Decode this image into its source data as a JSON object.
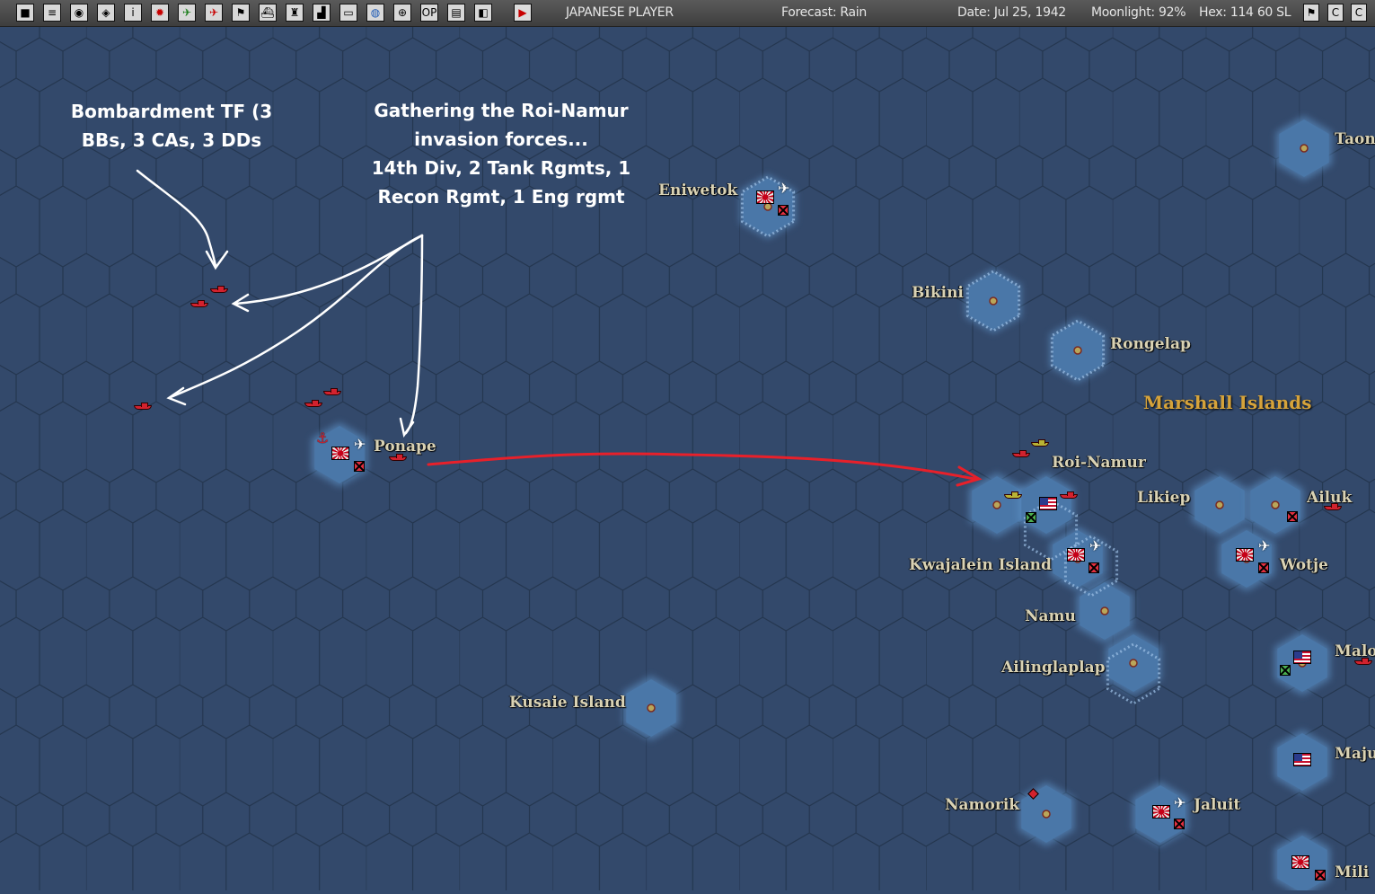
{
  "toolbar": {
    "buttons": [
      {
        "icon": "square-icon",
        "glyph": "■"
      },
      {
        "icon": "list-icon",
        "glyph": "≡"
      },
      {
        "icon": "pilots-icon",
        "glyph": "◉"
      },
      {
        "icon": "ships-icon",
        "glyph": "◈"
      },
      {
        "icon": "info-icon",
        "glyph": "i"
      },
      {
        "icon": "japan-flag-icon",
        "glyph": "✹"
      },
      {
        "icon": "aircraft-icon",
        "glyph": "✈"
      },
      {
        "icon": "bomber-icon",
        "glyph": "✈"
      },
      {
        "icon": "flag-icon",
        "glyph": "⚑"
      },
      {
        "icon": "ship-icon",
        "glyph": "⛴"
      },
      {
        "icon": "base-icon",
        "glyph": "♜"
      },
      {
        "icon": "chart-icon",
        "glyph": "▟"
      },
      {
        "icon": "cargo-icon",
        "glyph": "▭"
      },
      {
        "icon": "globe-icon",
        "glyph": "◍"
      },
      {
        "icon": "target-icon",
        "glyph": "⊕"
      },
      {
        "icon": "op-icon",
        "glyph": "OP"
      },
      {
        "icon": "memo-icon",
        "glyph": "▤"
      },
      {
        "icon": "window-icon",
        "glyph": "◧"
      },
      {
        "icon": "play-icon",
        "glyph": "▶"
      }
    ],
    "side": "JAPANESE PLAYER",
    "forecast": "Forecast: Rain",
    "date": "Date: Jul 25, 1942",
    "moonlight": "Moonlight: 92%",
    "hex": "Hex: 114  60  SL",
    "right_icons": [
      {
        "icon": "flag-icon",
        "glyph": "⚑"
      },
      {
        "icon": "close-icon",
        "glyph": "C"
      },
      {
        "icon": "minimize-icon",
        "glyph": "C"
      }
    ]
  },
  "map": {
    "region": "Marshall Islands",
    "places": [
      {
        "id": "eniwetok",
        "name": "Eniwetok"
      },
      {
        "id": "bikini",
        "name": "Bikini"
      },
      {
        "id": "rongelap",
        "name": "Rongelap"
      },
      {
        "id": "taongi",
        "name": "Taon"
      },
      {
        "id": "ponape",
        "name": "Ponape"
      },
      {
        "id": "roi-namur",
        "name": "Roi-Namur"
      },
      {
        "id": "likiep",
        "name": "Likiep"
      },
      {
        "id": "ailuk",
        "name": "Ailuk"
      },
      {
        "id": "kwajalein",
        "name": "Kwajalein Island"
      },
      {
        "id": "wotje",
        "name": "Wotje"
      },
      {
        "id": "namu",
        "name": "Namu"
      },
      {
        "id": "ailinglaplap",
        "name": "Ailinglaplap"
      },
      {
        "id": "maloelap",
        "name": "Malo"
      },
      {
        "id": "kusaie",
        "name": "Kusaie Island"
      },
      {
        "id": "majuro",
        "name": "Maju"
      },
      {
        "id": "namorik",
        "name": "Namorik"
      },
      {
        "id": "jaluit",
        "name": "Jaluit"
      },
      {
        "id": "mili",
        "name": "Mili"
      }
    ]
  },
  "annotations": {
    "bombardment": [
      "Bombardment TF (3",
      "BBs, 3 CAs, 3 DDs"
    ],
    "gathering": [
      "Gathering the Roi-Namur",
      "invasion forces...",
      "14th Div, 2 Tank Rgmts, 1",
      "Recon Rgmt, 1 Eng rgmt"
    ]
  },
  "colors": {
    "ocean": "#33496b",
    "shallow": "#4a77a8",
    "hex_grid": "#243650",
    "arrow_white": "#ffffff",
    "arrow_red": "#e8202a",
    "label": "#d9d2b4",
    "region": "#d6a33a"
  }
}
